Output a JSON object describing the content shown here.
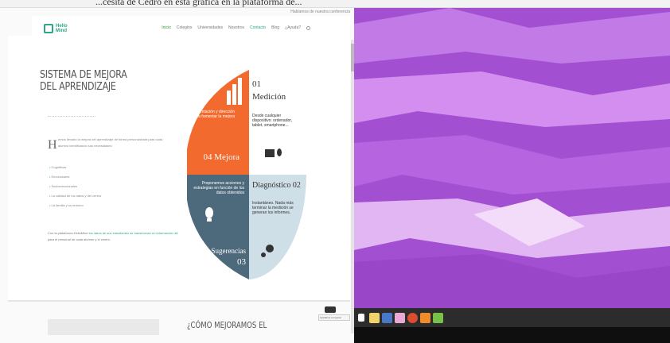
{
  "caption": "...cesita de Cedro en esta gráfica en la plataforma de...",
  "website": {
    "topbar": "Hablamos de nuestra conferencia",
    "logo_text": "Hello Mind",
    "nav": [
      "Inicio",
      "Colegios",
      "Universidades",
      "Nosotros",
      "Contacto",
      "Blog",
      "¿Ayuda?"
    ],
    "heading": "SISTEMA DE MEJORA DEL APRENDIZAJE",
    "dropcap": "H",
    "intro": "emos llevado la mejora del aprendizaje de forma personalizada para cada alumno identificando sus necesidades",
    "bullets": [
      "Cognitivas",
      "Emocionales",
      "Socioemocionales",
      "La calidad de los datos y del centro",
      "La familia y su entorno"
    ],
    "outro_1": "Con la plataforma HelloMind",
    "outro_hl": "los datos de sus estudiantes se transforman en información útil",
    "outro_2": "para el personal de cada alumno y el centro.",
    "bottom_heading": "¿CÓMO MEJORAMOS EL",
    "tooltip": "Ayúdanos a mejorar"
  },
  "wheel": {
    "s1_num": "01",
    "s1_title": "Medición",
    "s1_text": "Desde cualquier dispositivo: ordenador, tablet, smartphone...",
    "s2_title": "Diagnóstico 02",
    "s2_text": "Instantáneo. Nada más terminar la medición se generan los informes.",
    "s3_title": "Sugerencias",
    "s3_num": "03",
    "s3_text": "Proponemos acciones y estrategias en función de los datos obtenidos",
    "s4_title": "04 Mejora",
    "s4_text": "Orientación y dirección para fomentar la mejora",
    "colors": {
      "orange": "#f26a2e",
      "white": "#ffffff",
      "lightblue": "#cfdfe8",
      "slate": "#4d6a7d"
    }
  },
  "taskbar": {
    "icons": [
      "windows-start-icon",
      "file-explorer-icon",
      "folder-icon",
      "people-icon",
      "chrome-icon",
      "settings-icon",
      "android-icon"
    ]
  }
}
